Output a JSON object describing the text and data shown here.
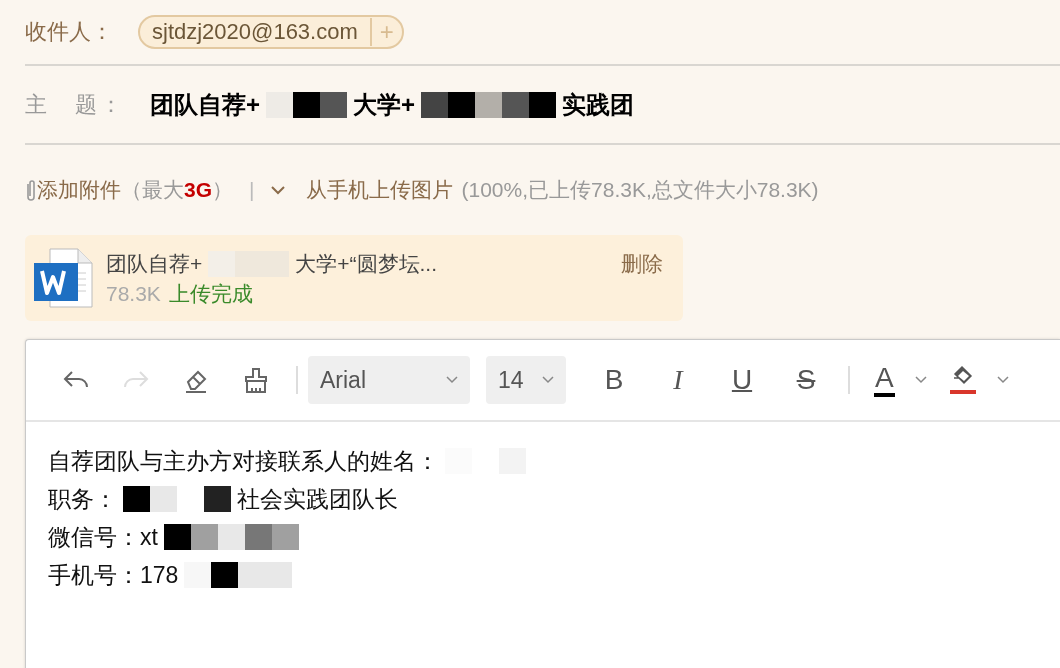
{
  "recipient": {
    "label": "收件人：",
    "chips": [
      {
        "address": "sjtdzj2020@163.com",
        "add": "+"
      }
    ]
  },
  "subject": {
    "label": "主　题：",
    "parts": [
      {
        "kind": "text",
        "text": "团队自荐+"
      },
      {
        "kind": "mosaic"
      },
      {
        "kind": "text",
        "text": "大学+"
      },
      {
        "kind": "mosaic"
      },
      {
        "kind": "text",
        "text": "实践团"
      }
    ]
  },
  "attach_bar": {
    "add_label": "添加附件",
    "limit_open": "（最大",
    "limit": "3G",
    "limit_close": "）",
    "separator": "|",
    "mobile_upload": "从手机上传图片",
    "status": "(100%,已上传78.3K,总文件大小78.3K)"
  },
  "attachments": [
    {
      "name_parts": [
        {
          "kind": "text",
          "text": "团队自荐+"
        },
        {
          "kind": "mosaic"
        },
        {
          "kind": "text",
          "text": "大学+“圆梦坛..."
        }
      ],
      "size": "78.3K",
      "status": "上传完成",
      "delete": "删除"
    }
  ],
  "toolbar": [
    {
      "kind": "undo",
      "disabled": false
    },
    {
      "kind": "redo",
      "disabled": true
    },
    {
      "kind": "eraser",
      "disabled": false
    },
    {
      "kind": "brush",
      "disabled": false
    },
    {
      "kind": "divider"
    },
    {
      "kind": "font",
      "text": "Arial"
    },
    {
      "kind": "size",
      "text": "14"
    },
    {
      "kind": "bold",
      "text": "B"
    },
    {
      "kind": "italic",
      "text": "I"
    },
    {
      "kind": "underline",
      "text": "U"
    },
    {
      "kind": "strike",
      "text": "S"
    },
    {
      "kind": "divider"
    },
    {
      "kind": "font_color",
      "text": "A",
      "color": "#000000"
    },
    {
      "kind": "fill_color",
      "color": "#d9362b"
    }
  ],
  "body": [
    [
      {
        "kind": "text",
        "text": "自荐团队与主办方对接联系人的姓名："
      },
      {
        "kind": "mosaic"
      }
    ],
    [
      {
        "kind": "text",
        "text": "职务："
      },
      {
        "kind": "mosaic"
      },
      {
        "kind": "text",
        "text": "社会实践团队长"
      }
    ],
    [
      {
        "kind": "text",
        "text": "微信号：xt"
      },
      {
        "kind": "mosaic"
      }
    ],
    [
      {
        "kind": "text",
        "text": "手机号：178"
      },
      {
        "kind": "mosaic"
      }
    ]
  ]
}
